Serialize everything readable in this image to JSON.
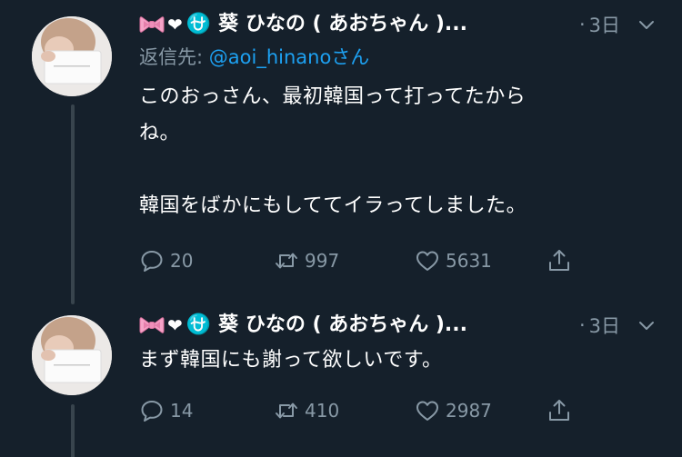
{
  "tweets": [
    {
      "author": {
        "display_name": "葵 ひなの ( あおちゃん )...",
        "ophiuchus_symbol": "⛎",
        "avatar": "avatar-photo"
      },
      "time_separator": "·",
      "time": "3日",
      "reply_to": {
        "prefix": "返信先: ",
        "handle": "@aoi_hinanoさん"
      },
      "text": "このおっさん、最初韓国って打ってたから\nね。\n\n韓国をばかにもしててイラってしました。",
      "counts": {
        "replies": "20",
        "retweets": "997",
        "likes": "5631"
      }
    },
    {
      "author": {
        "display_name": "葵 ひなの ( あおちゃん )...",
        "ophiuchus_symbol": "⛎",
        "avatar": "avatar-photo"
      },
      "time_separator": "·",
      "time": "3日",
      "text": "まず韓国にも謝って欲しいです。",
      "counts": {
        "replies": "14",
        "retweets": "410",
        "likes": "2987"
      }
    }
  ],
  "icons": {
    "ribbon": "ribbon-bow-icon",
    "heart": "heart-icon",
    "caret": "chevron-down-icon",
    "reply": "reply-icon",
    "retweet": "retweet-icon",
    "like": "like-heart-icon",
    "share": "share-icon"
  },
  "colors": {
    "background": "#15202b",
    "text": "#ffffff",
    "secondary": "#8899a6",
    "link": "#1da1f2",
    "thread_line": "#38444d",
    "ribbon": "#f5a3c7"
  }
}
